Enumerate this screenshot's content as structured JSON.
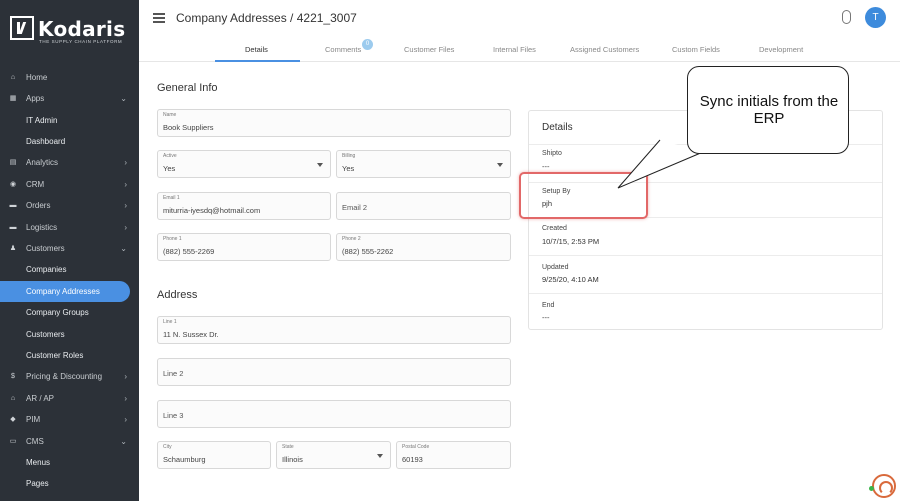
{
  "brand": {
    "name": "Kodaris",
    "tagline": "THE SUPPLY CHAIN PLATFORM"
  },
  "sidebar": {
    "items": [
      {
        "label": "Home",
        "icon": "home-icon",
        "glyph": "⌂",
        "chevron": ""
      },
      {
        "label": "Apps",
        "icon": "grid-icon",
        "glyph": "▦",
        "chevron": "⌄"
      },
      {
        "label": "IT Admin",
        "icon": "",
        "glyph": "",
        "chevron": ""
      },
      {
        "label": "Dashboard",
        "icon": "",
        "glyph": "",
        "chevron": ""
      },
      {
        "label": "Analytics",
        "icon": "chart-icon",
        "glyph": "▤",
        "chevron": "›"
      },
      {
        "label": "CRM",
        "icon": "user-circle-icon",
        "glyph": "◉",
        "chevron": "›"
      },
      {
        "label": "Orders",
        "icon": "truck-icon",
        "glyph": "▬",
        "chevron": "›"
      },
      {
        "label": "Logistics",
        "icon": "truck-icon",
        "glyph": "▬",
        "chevron": "›"
      },
      {
        "label": "Customers",
        "icon": "users-icon",
        "glyph": "♟",
        "chevron": "⌄"
      },
      {
        "label": "Companies",
        "icon": "",
        "glyph": "",
        "chevron": ""
      },
      {
        "label": "Company Addresses",
        "icon": "",
        "glyph": "",
        "chevron": ""
      },
      {
        "label": "Company Groups",
        "icon": "",
        "glyph": "",
        "chevron": ""
      },
      {
        "label": "Customers",
        "icon": "",
        "glyph": "",
        "chevron": ""
      },
      {
        "label": "Customer Roles",
        "icon": "",
        "glyph": "",
        "chevron": ""
      },
      {
        "label": "Pricing & Discounting",
        "icon": "dollar-icon",
        "glyph": "$",
        "chevron": "›"
      },
      {
        "label": "AR / AP",
        "icon": "bank-icon",
        "glyph": "⌂",
        "chevron": "›"
      },
      {
        "label": "PIM",
        "icon": "tag-icon",
        "glyph": "◆",
        "chevron": "›"
      },
      {
        "label": "CMS",
        "icon": "window-icon",
        "glyph": "▭",
        "chevron": "⌄"
      },
      {
        "label": "Menus",
        "icon": "",
        "glyph": "",
        "chevron": ""
      },
      {
        "label": "Pages",
        "icon": "",
        "glyph": "",
        "chevron": ""
      }
    ]
  },
  "header": {
    "title": "Company Addresses / 4221_3007",
    "avatar_initial": "T"
  },
  "tabs": [
    {
      "label": "Details"
    },
    {
      "label": "Comments"
    },
    {
      "label": "Customer Files"
    },
    {
      "label": "Internal Files"
    },
    {
      "label": "Assigned Customers"
    },
    {
      "label": "Custom Fields"
    },
    {
      "label": "Development"
    }
  ],
  "comments_count": "0",
  "general_info": {
    "title": "General Info",
    "name": {
      "label": "Name",
      "value": "Book Suppliers"
    },
    "active": {
      "label": "Active",
      "value": "Yes"
    },
    "billing": {
      "label": "Billing",
      "value": "Yes"
    },
    "email1": {
      "label": "Email 1",
      "value": "miturria-iyesdq@hotmail.com"
    },
    "email2": {
      "placeholder": "Email 2"
    },
    "phone1": {
      "label": "Phone 1",
      "value": "(882) 555-2269"
    },
    "phone2": {
      "label": "Phone 2",
      "value": "(882) 555-2262"
    }
  },
  "address": {
    "title": "Address",
    "line1": {
      "label": "Line 1",
      "value": "11 N. Sussex Dr."
    },
    "line2": {
      "placeholder": "Line 2"
    },
    "line3": {
      "placeholder": "Line 3"
    },
    "city": {
      "label": "City",
      "value": "Schaumburg"
    },
    "state": {
      "label": "State",
      "value": "Illinois"
    },
    "postal": {
      "label": "Postal Code",
      "value": "60193"
    }
  },
  "details": {
    "title": "Details",
    "rows": [
      {
        "label": "Shipto",
        "value": "---"
      },
      {
        "label": "Setup By",
        "value": "pjh"
      },
      {
        "label": "Created",
        "value": "10/7/15, 2:53 PM"
      },
      {
        "label": "Updated",
        "value": "9/25/20, 4:10 AM"
      },
      {
        "label": "End",
        "value": "---"
      }
    ]
  },
  "callout": {
    "text": "Sync initials from the ERP"
  },
  "colors": {
    "sidebar_bg": "#2c3138",
    "accent": "#4a90e2",
    "highlight": "#e26868"
  }
}
